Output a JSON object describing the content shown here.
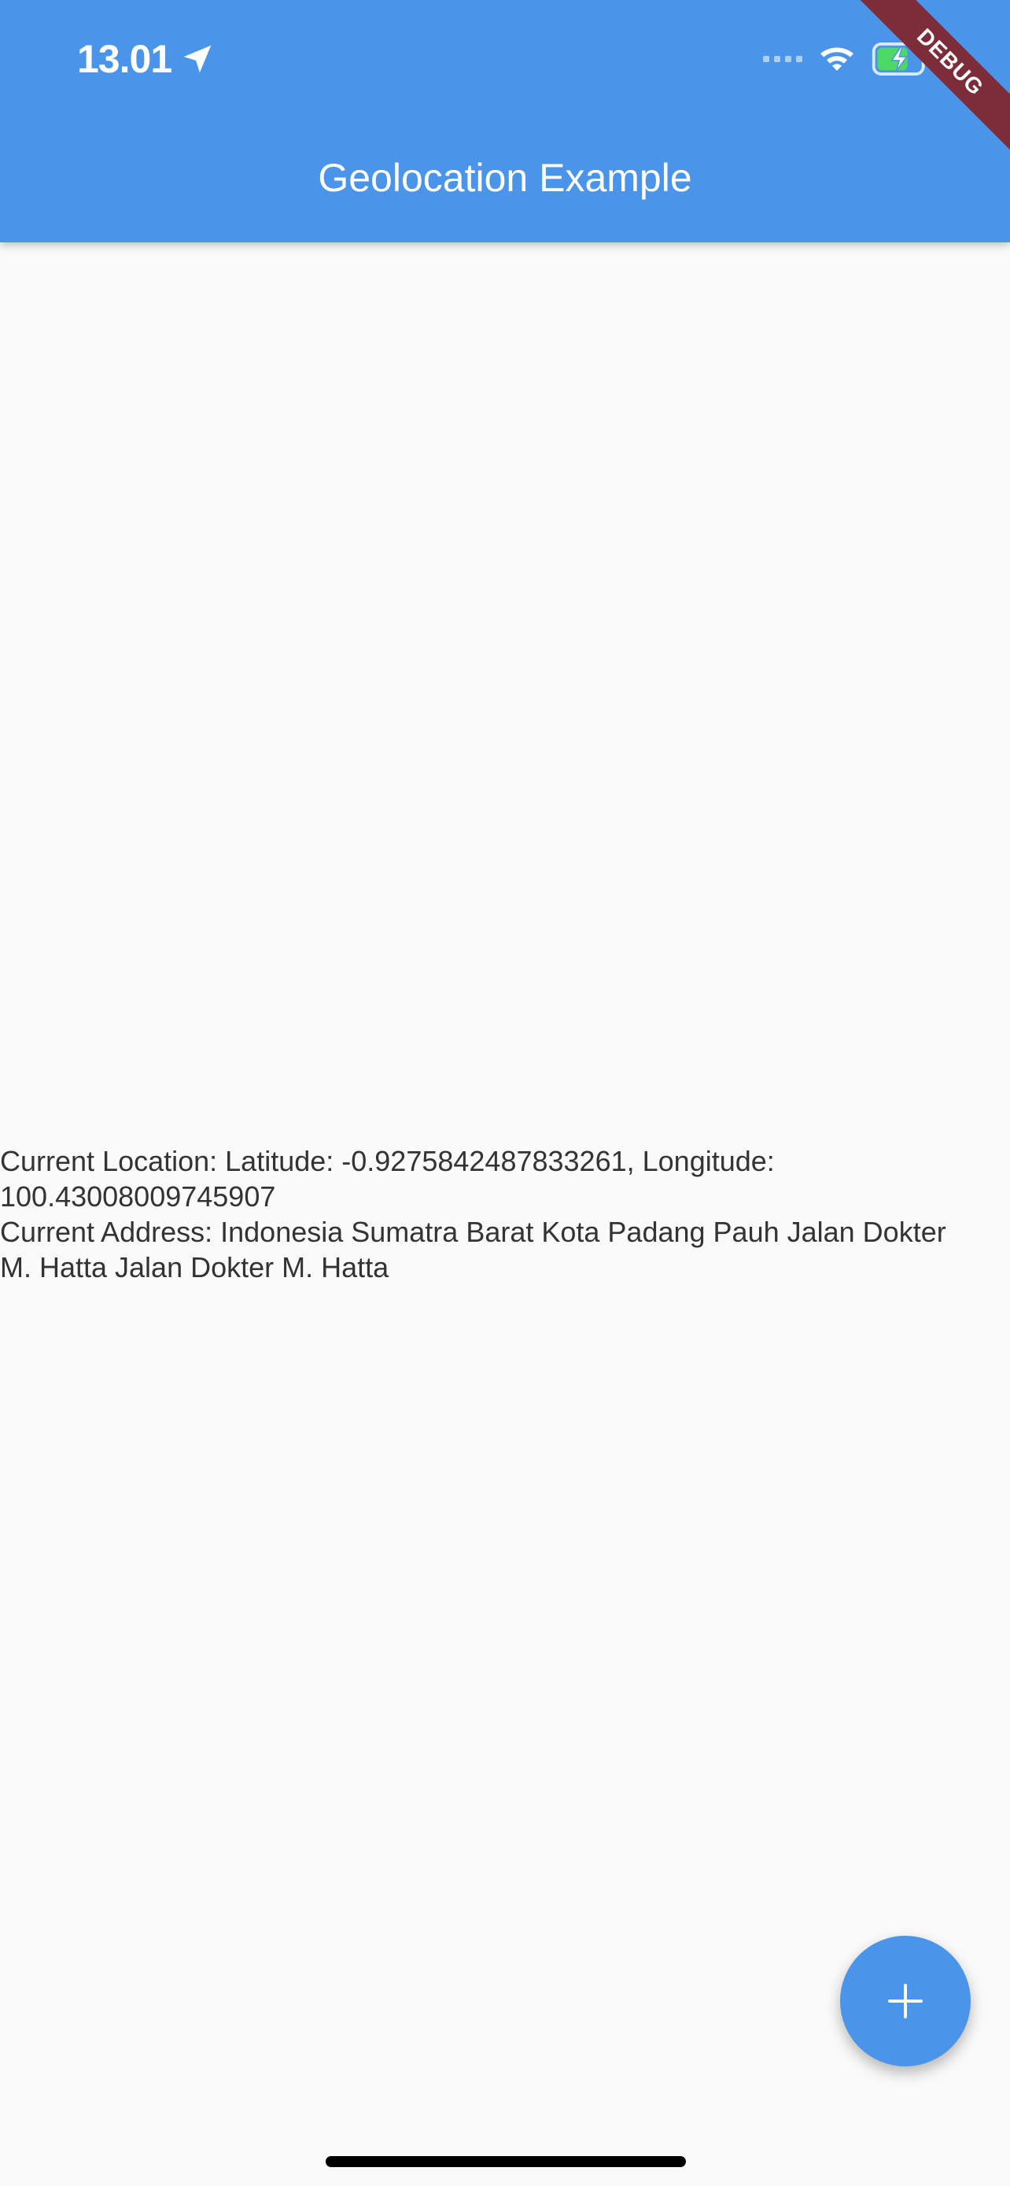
{
  "status_bar": {
    "time": "13.01",
    "location_icon": "location-arrow-icon",
    "signal_icon": "signal-dots-icon",
    "wifi_icon": "wifi-icon",
    "battery_icon": "battery-charging-icon"
  },
  "app_bar": {
    "title": "Geolocation Example",
    "background_color": "#4a95e9"
  },
  "debug_banner": {
    "label": "DEBUG",
    "color": "#7d2d3a"
  },
  "body": {
    "location_line": "Current Location: Latitude: -0.9275842487833261, Longitude: 100.43008009745907",
    "address_line": "Current Address: Indonesia  Sumatra Barat  Kota Padang Pauh Jalan Dokter M. Hatta  Jalan Dokter M. Hatta"
  },
  "fab": {
    "icon": "plus-icon",
    "color": "#4a95e9"
  }
}
